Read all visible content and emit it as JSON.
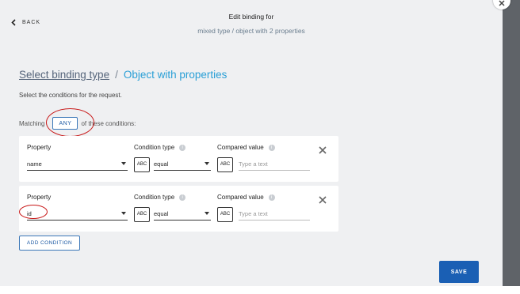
{
  "header": {
    "back_label": "BACK",
    "title": "Edit binding for",
    "subtitle": "mixed type / object with 2 properties"
  },
  "breadcrumb": {
    "link": "Select binding type",
    "separator": "/",
    "current": "Object with properties"
  },
  "description": "Select the conditions for the request.",
  "matching": {
    "prefix": "Matching",
    "mode": "ANY",
    "suffix": "of these conditions:"
  },
  "conditions": [
    {
      "property_label": "Property",
      "property_value": "name",
      "condition_label": "Condition type",
      "condition_type_icon": "ABC",
      "condition_value": "equal",
      "compared_label": "Compared value",
      "compared_type_icon": "ABC",
      "compared_placeholder": "Type a text"
    },
    {
      "property_label": "Property",
      "property_value": "id",
      "condition_label": "Condition type",
      "condition_type_icon": "ABC",
      "condition_value": "equal",
      "compared_label": "Compared value",
      "compared_type_icon": "ABC",
      "compared_placeholder": "Type a text"
    }
  ],
  "add_condition_label": "ADD CONDITION",
  "save_label": "SAVE",
  "colors": {
    "accent": "#2a9fd6",
    "primary_button": "#1a5fb4",
    "annotation": "#c81818"
  }
}
